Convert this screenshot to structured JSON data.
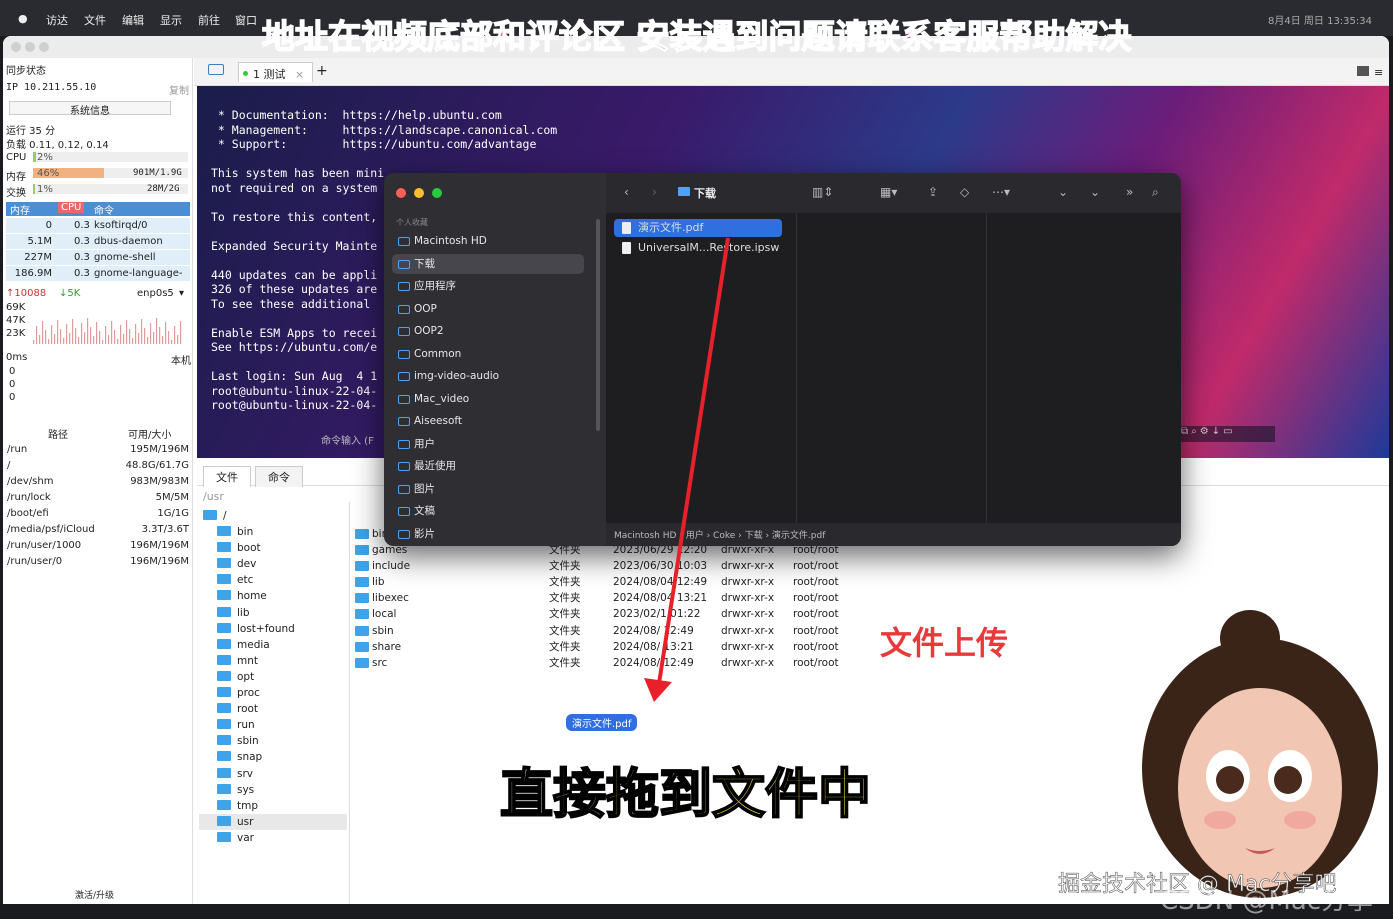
{
  "menubar": {
    "apple": "",
    "items": [
      "访达",
      "文件",
      "编辑",
      "显示",
      "前往",
      "窗口"
    ],
    "clock": "8月4日 周日 13:35:34"
  },
  "banner": "地址在视频底部和评论区 安装遇到问题请联系客服帮助解决",
  "toolbar": {
    "tab_label": "1 测试",
    "close": "×",
    "add": "+"
  },
  "sidebar": {
    "sync_label": "同步状态",
    "ip": "IP 10.211.55.10",
    "copy": "复制",
    "sysinfo_button": "系统信息",
    "uptime": "运行 35 分",
    "load": "负载 0.11, 0.12, 0.14",
    "cpu_label": "CPU",
    "cpu_pct": "2%",
    "cpu_value": 0.02,
    "mem_label": "内存",
    "mem_pct": "46%",
    "mem_value": 0.46,
    "mem_usage": "901M/1.9G",
    "swap_label": "交换",
    "swap_pct": "1%",
    "swap_value": 0.01,
    "swap_usage": "28M/2G",
    "proc_headers": [
      "内存",
      "CPU",
      "命令"
    ],
    "procs": [
      [
        "0",
        "0.3",
        "ksoftirqd/0"
      ],
      [
        "5.1M",
        "0.3",
        "dbus-daemon"
      ],
      [
        "227M",
        "0.3",
        "gnome-shell"
      ],
      [
        "186.9M",
        "0.3",
        "gnome-language-"
      ]
    ],
    "net_up": "10088",
    "net_down": "5K",
    "net_iface": "enp0s5",
    "net_scale": [
      "69K",
      "47K",
      "23K"
    ],
    "ping_label": "0ms",
    "ping_host": "本机",
    "ping_vals": [
      "0",
      "0",
      "0"
    ],
    "disk_headers": [
      "路径",
      "可用/大小"
    ],
    "disks": [
      [
        "/run",
        "195M/196M"
      ],
      [
        "/",
        "48.8G/61.7G"
      ],
      [
        "/dev/shm",
        "983M/983M"
      ],
      [
        "/run/lock",
        "5M/5M"
      ],
      [
        "/boot/efi",
        "1G/1G"
      ],
      [
        "/media/psf/iCloud",
        "3.3T/3.6T"
      ],
      [
        "/run/user/1000",
        "196M/196M"
      ],
      [
        "/run/user/0",
        "196M/196M"
      ]
    ],
    "activate": "激活/升级"
  },
  "terminal": {
    "lines": [
      " * Documentation:  https://help.ubuntu.com",
      " * Management:     https://landscape.canonical.com",
      " * Support:        https://ubuntu.com/advantage",
      "",
      "This system has been mini",
      "not required on a system",
      "",
      "To restore this content,",
      "",
      "Expanded Security Mainte",
      "",
      "440 updates can be appli",
      "326 of these updates are",
      "To see these additional",
      "",
      "Enable ESM Apps to recei",
      "See https://ubuntu.com/e",
      "",
      "Last login: Sun Aug  4 1",
      "root@ubuntu-linux-22-04-",
      "root@ubuntu-linux-22-04-"
    ],
    "input_hint": "命令输入 (F"
  },
  "filetabs": [
    "文件",
    "命令"
  ],
  "path": "/usr",
  "tree": [
    "/",
    "bin",
    "boot",
    "dev",
    "etc",
    "home",
    "lib",
    "lost+found",
    "media",
    "mnt",
    "opt",
    "proc",
    "root",
    "run",
    "sbin",
    "snap",
    "srv",
    "sys",
    "tmp",
    "usr",
    "var"
  ],
  "files": [
    [
      "bin",
      "",
      "",
      ""
    ],
    [
      "games",
      "文件夹",
      "2023/06/29 12:20",
      "drwxr-xr-x",
      "root/root"
    ],
    [
      "include",
      "文件夹",
      "2023/06/30 10:03",
      "drwxr-xr-x",
      "root/root"
    ],
    [
      "lib",
      "文件夹",
      "2024/08/04 12:49",
      "drwxr-xr-x",
      "root/root"
    ],
    [
      "libexec",
      "文件夹",
      "2024/08/04 13:21",
      "drwxr-xr-x",
      "root/root"
    ],
    [
      "local",
      "文件夹",
      "2023/02/1 01:22",
      "drwxr-xr-x",
      "root/root"
    ],
    [
      "sbin",
      "文件夹",
      "2024/08/ 12:49",
      "drwxr-xr-x",
      "root/root"
    ],
    [
      "share",
      "文件夹",
      "2024/08/ 13:21",
      "drwxr-xr-x",
      "root/root"
    ],
    [
      "src",
      "文件夹",
      "2024/08/ 12:49",
      "drwxr-xr-x",
      "root/root"
    ]
  ],
  "finder": {
    "section": "个人收藏",
    "items": [
      "Macintosh HD",
      "下载",
      "应用程序",
      "OOP",
      "OOP2",
      "Common",
      "img-video-audio",
      "Mac_video",
      "Aiseesoft",
      "用户",
      "最近使用",
      "图片",
      "文稿",
      "影片"
    ],
    "title": "下载",
    "files": [
      "演示文件.pdf",
      "UniversalM...Restore.ipsw"
    ],
    "breadcrumb": "Macintosh HD › 用户 › Coke › 下载 › 演示文件.pdf"
  },
  "overlay": {
    "upload": "文件上传",
    "caption_white": "直接",
    "caption_yellow": "拖到文件中",
    "drag_label": "演示文件.pdf",
    "wm1": "掘金技术社区 @ Mac分享吧",
    "wm2": "CSDN @Mac分享吧"
  },
  "colors": {
    "selection": "#2f6fe0",
    "arrow": "#e8202a",
    "accent": "#3ea3e8"
  }
}
